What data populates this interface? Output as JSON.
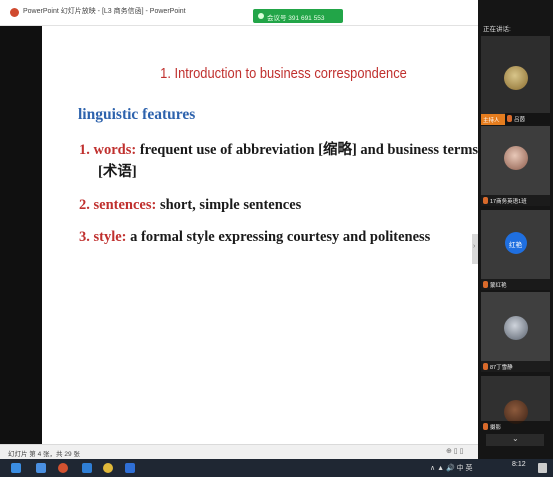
{
  "window": {
    "app_title": "PowerPoint 幻灯片放映 - [L3 商务信函] - PowerPoint",
    "meeting_id": "会议号 391 691 553"
  },
  "slide": {
    "title": "1. Introduction to business correspondence",
    "heading": "linguistic features",
    "points": [
      {
        "num": "1.",
        "term": "words:",
        "text": "frequent use of abbreviation [缩略] and business terms",
        "continuation": "[术语]"
      },
      {
        "num": "2.",
        "term": "sentences:",
        "text": "short, simple sentences"
      },
      {
        "num": "3.",
        "term": "style:",
        "text": "a formal style expressing courtesy and politeness"
      }
    ]
  },
  "statusbar": {
    "slide_count": "幻灯片 第 4 张，共 29 张",
    "view_controls": "⊕  ▯  ▯"
  },
  "video_panel": {
    "speaker_label": "正在讲话:",
    "host_badge": "主持人",
    "tiles": [
      {
        "name": "吕茵"
      },
      {
        "name": "17商务英语1班"
      },
      {
        "name": "蒙红艳",
        "avatar_text": "红艳"
      },
      {
        "name": "87丁雪静"
      },
      {
        "name": "摄影"
      }
    ],
    "collapse_icon": "chevron-down-icon"
  },
  "taskbar": {
    "tray": "∧ ▲ 🔊 中 英",
    "time": "8:12",
    "icons": [
      "windows-start-icon",
      "file-explorer-icon",
      "powerpoint-icon",
      "browser-icon",
      "chrome-icon",
      "meeting-app-icon"
    ]
  }
}
